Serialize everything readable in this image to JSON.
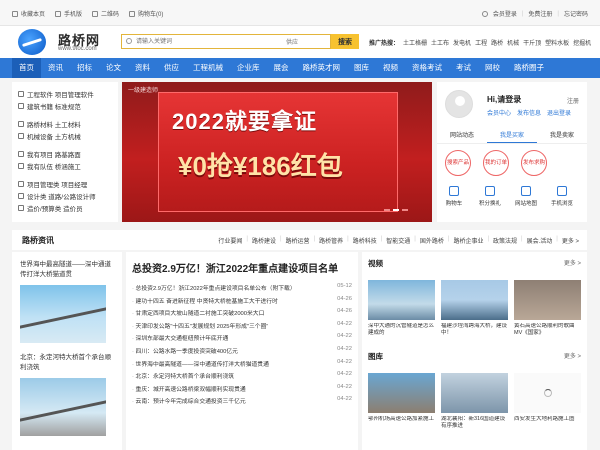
{
  "topbar": {
    "left": [
      {
        "icon": "star-icon",
        "label": "收藏本页"
      },
      {
        "icon": "mobile-icon",
        "label": "手机版"
      },
      {
        "icon": "qrcode-icon",
        "label": "二维码"
      },
      {
        "icon": "cart-icon",
        "label": "购物车(0)"
      }
    ],
    "right": [
      "会员登录",
      "免费注册",
      "忘记密码"
    ]
  },
  "header": {
    "logo_name": "路桥网",
    "logo_url": "www.9toc.com",
    "search_placeholder": "请输入关键词",
    "search_select": "供应",
    "search_button": "搜索",
    "hot_label": "推广热搜：",
    "hot_items": [
      "土工格栅",
      "土工布",
      "发电机",
      "工程",
      "路桥",
      "机械",
      "干斤顶",
      "塑料水板",
      "挖掘机"
    ]
  },
  "nav": [
    "首页",
    "资讯",
    "招标",
    "论文",
    "资料",
    "供应",
    "工程机械",
    "企业库",
    "展会",
    "路桥英才网",
    "图库",
    "视频",
    "资格考试",
    "考试",
    "网校",
    "路桥圈子"
  ],
  "sidebar": {
    "groups": [
      [
        "工程软件 项目管理软件",
        "建筑书籍 标准规范"
      ],
      [
        "路桥材料 土工材料",
        "机械设备 土方机械"
      ],
      [
        "我有项目 路基路面",
        "我有队伍 桥涵施工"
      ],
      [
        "项目管理类 项目经理",
        "设计类 道路/公路设计师",
        "造价/预算类 造价员"
      ]
    ]
  },
  "banner": {
    "tag": "一级建造师",
    "line1": "2022就要拿证",
    "line2": "¥0抢¥186红包"
  },
  "user": {
    "greeting": "Hi,请登录",
    "register": "注册",
    "links": [
      "会员中心",
      "发布信息",
      "退出登录"
    ],
    "tabs": [
      "网站动态",
      "我是买家",
      "我是卖家"
    ],
    "circles": [
      "搜索产品",
      "我的订单",
      "发布求购"
    ],
    "icons": [
      "购物车",
      "积分换礼",
      "网站地图",
      "手机浏览"
    ]
  },
  "section": {
    "title": "路桥资讯",
    "links": [
      "行业要闻",
      "路桥建设",
      "路桥运营",
      "路桥管养",
      "路桥科技",
      "智能交通",
      "国外路桥",
      "路桥企事业",
      "政策法规",
      "展会.活动",
      "更多 >"
    ]
  },
  "left_col": {
    "items": [
      "世界海中最高隧道——深中通道传打洋大桥猫道贯",
      "北京：永定河特大桥首个承台顺利浇筑"
    ]
  },
  "mid_col": {
    "headline": "总投资2.9万亿！浙江2022年重点建设项目名单",
    "news": [
      {
        "title": "总投资2.9万亿！浙江2022年重点建设项目名单公布（附下载）",
        "date": "05-12"
      },
      {
        "title": "建功十四五 奋进新征程 中贤特大桥桩基施工大干进行时",
        "date": "04-26"
      },
      {
        "title": "甘肃定西项目大坡山隧道二衬施工突破2000米大口",
        "date": "04-26"
      },
      {
        "title": "天津印发公路\"十四五\"发展规划 2025年形成\"三个圈\"",
        "date": "04-22"
      },
      {
        "title": "深圳东部最大交通枢纽预计年底开通",
        "date": "04-22"
      },
      {
        "title": "四川：公路水路一季度投资突破400亿元",
        "date": "04-22"
      },
      {
        "title": "世界海中最高隧道——深中通道传打洋大桥猫道贯通",
        "date": "04-22"
      },
      {
        "title": "北京：永定河特大桥首个承台顺利浇筑",
        "date": "04-22"
      },
      {
        "title": "重庆：城开高速公路桥梁双幅顺利实现贯通",
        "date": "04-22"
      },
      {
        "title": "云南：预计今年完成综合交通投资三千亿元",
        "date": "04-22"
      }
    ]
  },
  "right_col": {
    "video_title": "视频",
    "video_more": "更多 >",
    "videos": [
      "深中大通的沉管隧道是怎么建成的",
      "福建沙埕湾跨海大桥，建设中！",
      "黄石高速公路顺利的歌曲MV《国家》"
    ],
    "gallery_title": "图库",
    "gallery_more": "更多 >",
    "gallery": [
      "鄂州机场高速公路加紧施工",
      "湖北襄阳：新316国道建设有序推进",
      "西安发生大地利路施工图"
    ]
  },
  "colors": {
    "nav_bg": "#2e78d6",
    "search_btn": "#f7c230",
    "banner_red": "#c21f1f"
  }
}
